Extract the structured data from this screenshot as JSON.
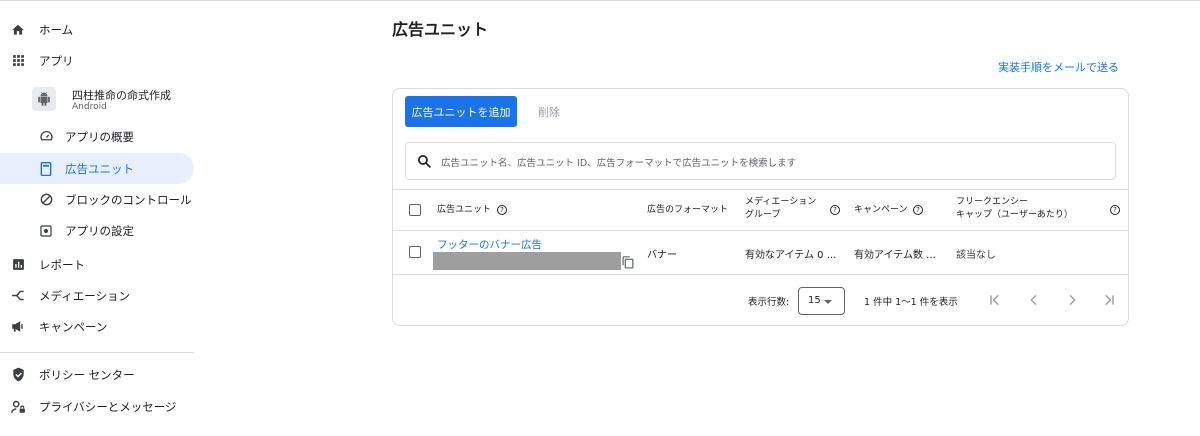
{
  "sidebar": {
    "items": [
      {
        "label": "ホーム",
        "icon": "home-icon"
      },
      {
        "label": "アプリ",
        "icon": "apps-grid-icon"
      },
      {
        "label": "アプリの概要",
        "icon": "speed-gauge-icon"
      },
      {
        "label": "広告ユニット",
        "icon": "ad-unit-icon"
      },
      {
        "label": "ブロックのコントロール",
        "icon": "block-icon"
      },
      {
        "label": "アプリの設定",
        "icon": "settings-icon"
      },
      {
        "label": "レポート",
        "icon": "bar-chart-icon"
      },
      {
        "label": "メディエーション",
        "icon": "mediation-icon"
      },
      {
        "label": "キャンペーン",
        "icon": "megaphone-icon"
      },
      {
        "label": "ポリシー センター",
        "icon": "shield-check-icon"
      },
      {
        "label": "プライバシーとメッセージ",
        "icon": "person-lock-icon"
      }
    ],
    "app": {
      "name": "四柱推命の命式作成",
      "platform": "Android",
      "icon": "android-icon"
    }
  },
  "main": {
    "title": "広告ユニット",
    "email_link": "実装手順をメールで送る",
    "add_button": "広告ユニットを追加",
    "delete_button": "削除",
    "search_placeholder": "広告ユニット名、広告ユニット ID、広告フォーマットで広告ユニットを検索します",
    "table": {
      "headers": {
        "ad_unit": "広告ユニット",
        "format": "広告のフォーマット",
        "mediation_line1": "メディエーション",
        "mediation_line2": "グループ",
        "campaign": "キャンペーン",
        "frequency_line1": "フリークエンシー",
        "frequency_line2": "キャップ（ユーザーあたり）"
      },
      "rows": [
        {
          "name": "フッターのバナー広告",
          "format": "バナー",
          "mediation": "有効なアイテム 0 ...",
          "campaign": "有効アイテム数 ...",
          "frequency": "該当なし"
        }
      ]
    },
    "pagination": {
      "rows_label": "表示行数:",
      "rows_value": "15",
      "range_text": "1 件中 1〜1 件を表示"
    }
  },
  "colors": {
    "accent": "#1a73e8",
    "active_bg": "#e8f0fe",
    "border": "#dadce0",
    "text": "#202124",
    "muted": "#5f6368"
  }
}
